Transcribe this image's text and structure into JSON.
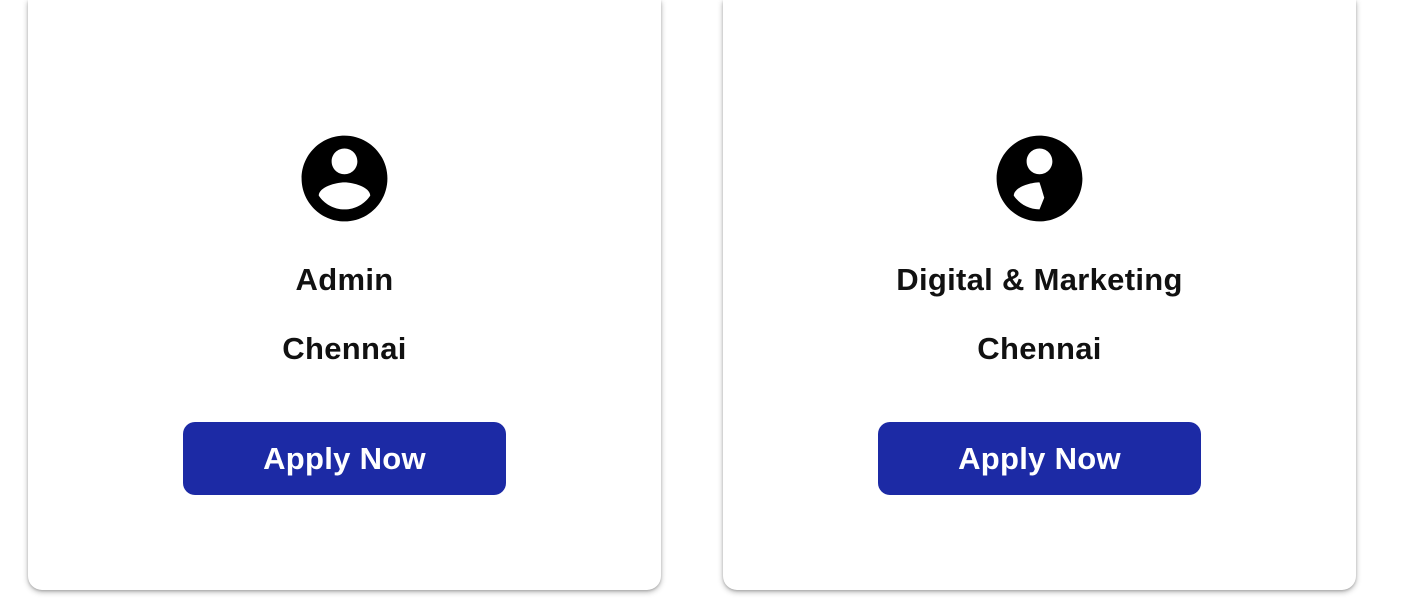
{
  "jobs": [
    {
      "icon": "account-circle-icon",
      "title": "Admin",
      "location": "Chennai",
      "apply_label": "Apply Now"
    },
    {
      "icon": "account-circle-icon",
      "title": "Digital & Marketing",
      "location": "Chennai",
      "apply_label": "Apply Now"
    }
  ],
  "colors": {
    "button_bg": "#1c2aa5",
    "button_text": "#ffffff",
    "text": "#111111",
    "card_bg": "#ffffff"
  }
}
